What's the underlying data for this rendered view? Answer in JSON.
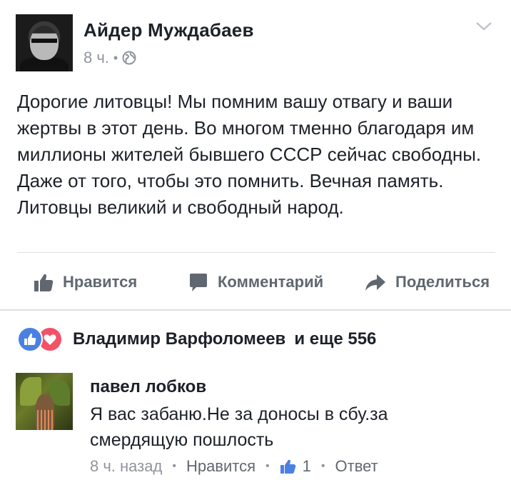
{
  "post": {
    "author": "Айдер Муждабаев",
    "time": "8 ч.",
    "separator": "•",
    "text": "Дорогие литовцы! Мы помним вашу отвагу и ваши жертвы в этот день. Во многом тменно благодаря им миллионы жителей бывшего СССР сейчас свободны. Даже от того, чтобы это помнить. Вечная память. Литовцы великий и свободный народ."
  },
  "actions": {
    "like": "Нравится",
    "comment": "Комментарий",
    "share": "Поделиться"
  },
  "reactions": {
    "name": "Владимир Варфоломеев",
    "more": "и еще 556"
  },
  "comment": {
    "author": "павел лобков",
    "text": "Я вас забаню.Не за доносы в сбу.за смердящую пошлость",
    "time": "8 ч. назад",
    "like": "Нравится",
    "like_count": "1",
    "reply": "Ответ",
    "separator": "•"
  },
  "icons": {
    "visibility": "globe-icon",
    "menu": "chevron-down-icon",
    "like": "thumbs-up-icon",
    "comment": "comment-bubble-icon",
    "share": "share-arrow-icon",
    "reaction_like": "like-reaction-icon",
    "reaction_love": "love-reaction-icon"
  },
  "colors": {
    "text": "#1d2129",
    "secondary": "#90949c",
    "action": "#606770",
    "like_blue": "#4b80e3",
    "love_red": "#f25268"
  }
}
